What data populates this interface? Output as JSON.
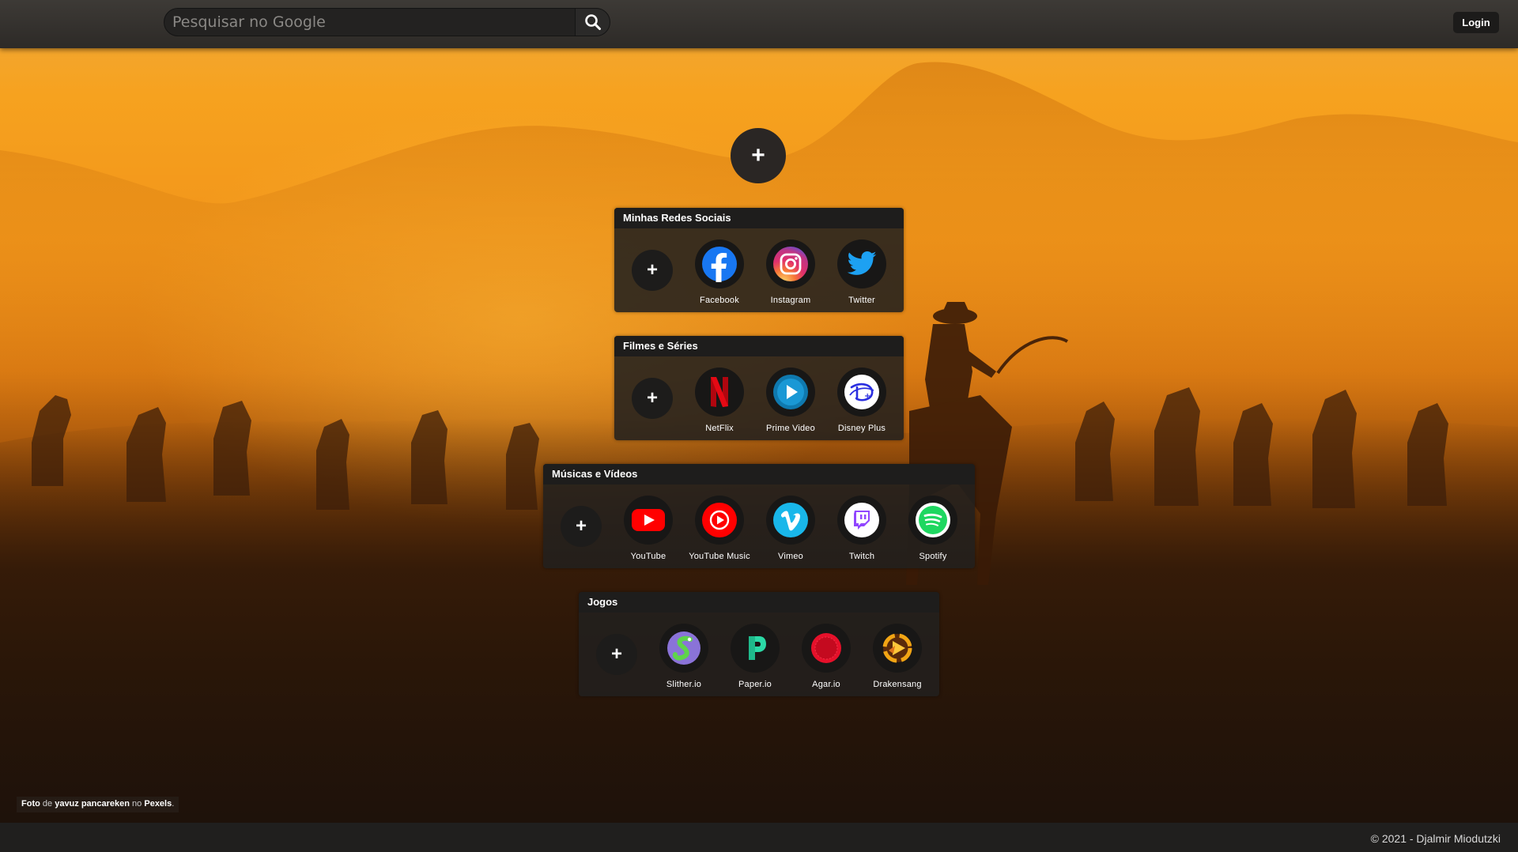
{
  "header": {
    "search": {
      "placeholder": "Pesquisar no Google",
      "value": ""
    },
    "search_icon": "search-icon",
    "login_label": "Login"
  },
  "add_main_label": "+",
  "groups": [
    {
      "title": "Minhas Redes Sociais",
      "add_label": "+",
      "items": [
        {
          "label": "Facebook",
          "icon": "facebook-icon"
        },
        {
          "label": "Instagram",
          "icon": "instagram-icon"
        },
        {
          "label": "Twitter",
          "icon": "twitter-icon"
        }
      ]
    },
    {
      "title": "Filmes e Séries",
      "add_label": "+",
      "items": [
        {
          "label": "NetFlix",
          "icon": "netflix-icon"
        },
        {
          "label": "Prime Video",
          "icon": "prime-video-icon"
        },
        {
          "label": "Disney Plus",
          "icon": "disney-plus-icon"
        }
      ]
    },
    {
      "title": "Músicas e Vídeos",
      "add_label": "+",
      "items": [
        {
          "label": "YouTube",
          "icon": "youtube-icon"
        },
        {
          "label": "YouTube Music",
          "icon": "youtube-music-icon"
        },
        {
          "label": "Vimeo",
          "icon": "vimeo-icon"
        },
        {
          "label": "Twitch",
          "icon": "twitch-icon"
        },
        {
          "label": "Spotify",
          "icon": "spotify-icon"
        }
      ]
    },
    {
      "title": "Jogos",
      "add_label": "+",
      "items": [
        {
          "label": "Slither.io",
          "icon": "slither-io-icon"
        },
        {
          "label": "Paper.io",
          "icon": "paper-io-icon"
        },
        {
          "label": "Agar.io",
          "icon": "agar-io-icon"
        },
        {
          "label": "Drakensang",
          "icon": "drakensang-icon"
        }
      ]
    }
  ],
  "credit": {
    "prefix": "Foto",
    "de": "de",
    "author": "yavuz pancareken",
    "no": "no",
    "site": "Pexels",
    "suffix": "."
  },
  "footer_text": "© 2021 - Djalmir Miodutzki",
  "colors": {
    "topbar": "#2d2a27",
    "panel": "#22201e",
    "sky": "#f6a21f",
    "facebook": "#1877f2",
    "youtube": "#ff0000",
    "twitch": "#9146ff",
    "spotify": "#1ed760"
  }
}
